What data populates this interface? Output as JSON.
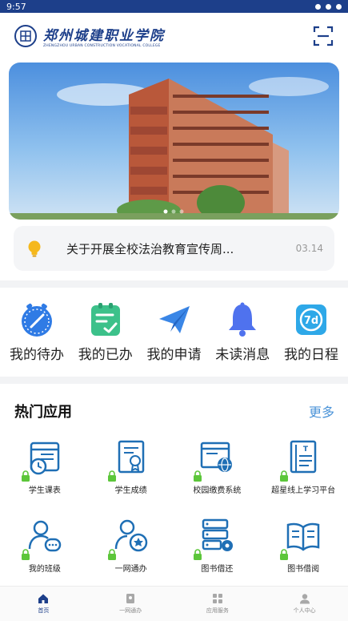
{
  "status_bar": {
    "time": "9:57"
  },
  "header": {
    "school_name": "郑州城建职业学院",
    "school_name_en": "ZHENGZHOU URBAN CONSTRUCTION VOCATIONAL COLLEGE",
    "scan_icon": "scan-icon"
  },
  "notice": {
    "text": "关于开展全校法治教育宣传周...",
    "date": "03.14",
    "icon": "lightbulb-icon"
  },
  "quick_actions": [
    {
      "label": "我的待办",
      "icon": "stopwatch-icon",
      "color": "#2f7be5"
    },
    {
      "label": "我的已办",
      "icon": "clipboard-check-icon",
      "color": "#3cc18a"
    },
    {
      "label": "我的申请",
      "icon": "paper-plane-icon",
      "color": "#3a86e6"
    },
    {
      "label": "未读消息",
      "icon": "bell-icon",
      "color": "#4f72ee"
    },
    {
      "label": "我的日程",
      "icon": "calendar-7d-icon",
      "color": "#2ea8e8"
    }
  ],
  "hot_apps": {
    "title": "热门应用",
    "more": "更多",
    "items": [
      {
        "label": "学生课表",
        "icon": "schedule-clock-icon"
      },
      {
        "label": "学生成绩",
        "icon": "certificate-icon"
      },
      {
        "label": "校园缴费系统",
        "icon": "browser-globe-icon"
      },
      {
        "label": "超星线上学习平台",
        "icon": "book-text-icon"
      },
      {
        "label": "我的班级",
        "icon": "users-chat-icon"
      },
      {
        "label": "一网通办",
        "icon": "user-badge-icon"
      },
      {
        "label": "图书借还",
        "icon": "server-gear-icon"
      },
      {
        "label": "图书借阅",
        "icon": "open-book-icon"
      }
    ]
  },
  "tabbar": {
    "items": [
      {
        "label": "首页",
        "icon": "home-icon",
        "active": true
      },
      {
        "label": "一网通办",
        "icon": "service-icon",
        "active": false
      },
      {
        "label": "应用服务",
        "icon": "apps-grid-icon",
        "active": false
      },
      {
        "label": "个人中心",
        "icon": "person-icon",
        "active": false
      }
    ]
  },
  "colors": {
    "brand": "#1d3f8a",
    "accent_more": "#4a93d8",
    "app_icon_blue": "#1f6fb5",
    "lock_green": "#5cc63a"
  }
}
